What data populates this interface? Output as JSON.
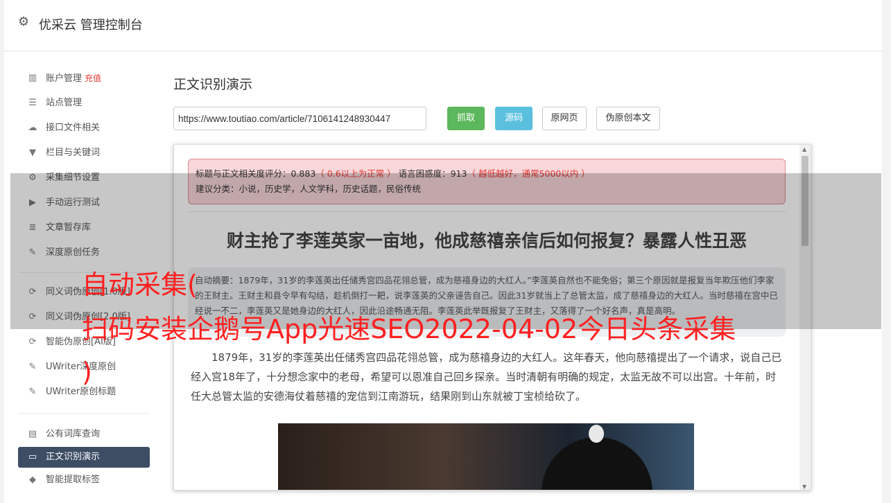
{
  "header": {
    "title": "优采云 管理控制台"
  },
  "sidebar": {
    "group1": [
      {
        "label": "账户管理",
        "badge": "充值"
      },
      {
        "label": "站点管理"
      },
      {
        "label": "接口文件相关"
      },
      {
        "label": "栏目与关键词"
      },
      {
        "label": "采集细节设置"
      },
      {
        "label": "手动运行测试"
      },
      {
        "label": "文章暂存库"
      },
      {
        "label": "深度原创任务"
      }
    ],
    "group2": [
      {
        "label": "同义词伪原创[1.0版]"
      },
      {
        "label": "同义词伪原创[2.0版]"
      },
      {
        "label": "智能伪原创[AI版]"
      },
      {
        "label": "UWriter深度原创"
      },
      {
        "label": "UWriter原创标题"
      }
    ],
    "group3": [
      {
        "label": "公有词库查询"
      },
      {
        "label": "正文识别演示"
      },
      {
        "label": "智能提取标签"
      }
    ]
  },
  "main": {
    "page_title": "正文识别演示",
    "url_value": "https://www.toutiao.com/article/7106141248930447",
    "buttons": {
      "fetch": "抓取",
      "source": "源码",
      "original_page": "原网页",
      "pseudo_original": "伪原创本文"
    }
  },
  "result": {
    "score_label": "标题与正文相关度评分：0.883",
    "score_hint": "（ 0.6以上为正常 ）",
    "perplexity_label": " 语言困惑度：913",
    "perplexity_hint": "（ 越低越好，通常5000以内 ）",
    "category": "建议分类：小说，历史学，人文学科，历史话题，民俗传统",
    "article_title": "财主抢了李莲英家一亩地，他成慈禧亲信后如何报复？暴露人性丑恶",
    "summary": "自动摘要：1879年，31岁的李莲英出任储秀宫四品花翎总管，成为慈禧身边的大红人。”李莲英自然也不能免俗；第三个原因就是报复当年欺压他们李家的王财主。王财主和县令早有勾结，趁机倒打一耙，说李莲英的父亲诬告自己。因此31岁就当上了总管太监，成了慈禧身边的大红人。当时慈禧在宫中已经说一不二，李莲英又是她身边的大红人，因此沿途畅通无阻。李莲英此举既报复了王财主，又落得了一个好名声，真是高明。",
    "paragraph": "1879年，31岁的李莲英出任储秀宫四品花翎总管，成为慈禧身边的大红人。这年春天，他向慈禧提出了一个请求，说自己已经入宫18年了，十分想念家中的老母，希望可以恩准自己回乡探亲。当时清朝有明确的规定，太监无故不可以出宫。十年前，时任大总管太监的安德海仗着慈禧的宠信到江南游玩，结果刚到山东就被丁宝桢给砍了。"
  },
  "watermark": {
    "line1": "自动采集(",
    "line2": "扫码安装企鹅号App光速SEO2022-04-02今日头条采集",
    "line3": ")"
  }
}
